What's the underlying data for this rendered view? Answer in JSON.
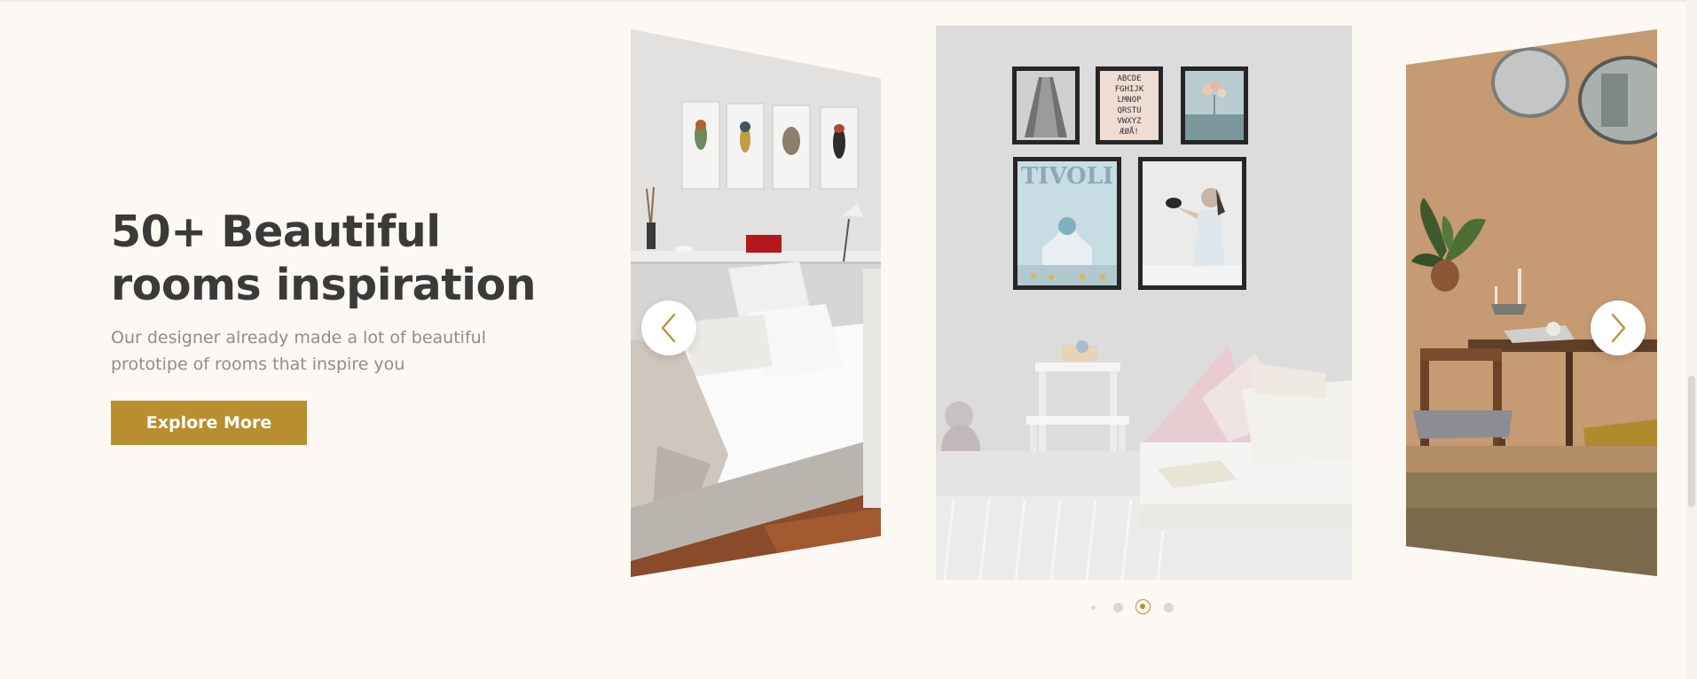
{
  "hero": {
    "title": "50+ Beautiful rooms inspiration",
    "description": "Our designer already made a lot of beautiful prototipe of rooms that inspire you",
    "cta_label": "Explore More"
  },
  "carousel": {
    "slide_count": 4,
    "active_index": 2,
    "center_art": {
      "alphabet_poster_rows": [
        "ABCDE",
        "FGHIJK",
        "LMNOP",
        "QRSTU",
        "VWXYZ",
        "ÆØÅ!"
      ],
      "tivoli_poster_text": "TIVOLI"
    }
  },
  "colors": {
    "background": "#fcf8f3",
    "accent": "#b88e2f",
    "title": "#3a3a3a",
    "muted_text": "#8e8e8e"
  },
  "icons": {
    "prev": "chevron-left-icon",
    "next": "chevron-right-icon"
  }
}
